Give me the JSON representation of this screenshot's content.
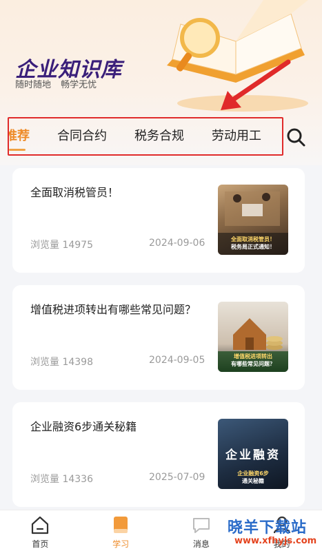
{
  "header": {
    "title": "企业知识库",
    "subtitle_left": "随时随地",
    "subtitle_right": "畅学无忧"
  },
  "tabs": [
    {
      "label": "推荐",
      "active": true
    },
    {
      "label": "合同合约",
      "active": false
    },
    {
      "label": "税务合规",
      "active": false
    },
    {
      "label": "劳动用工",
      "active": false
    }
  ],
  "articles": [
    {
      "title": "全面取消税管员！",
      "views": "浏览量 14975",
      "date": "2024-09-06",
      "thumb_line1": "全面取消税管员！",
      "thumb_line2": "税务局正式通知！"
    },
    {
      "title": "增值税进项转出有哪些常见问题？",
      "views": "浏览量 14398",
      "date": "2024-09-05",
      "thumb_line1": "增值税进项转出",
      "thumb_line2": "有哪些常见问题？"
    },
    {
      "title": "企业融资6步通关秘籍",
      "views": "浏览量 14336",
      "date": "2025-07-09",
      "thumb_big": "企业融资",
      "thumb_line1": "企业融资6步",
      "thumb_line2": "通关秘籍"
    }
  ],
  "tabbar": [
    {
      "label": "首页",
      "icon": "home-icon"
    },
    {
      "label": "学习",
      "icon": "book-icon",
      "active": true
    },
    {
      "label": "消息",
      "icon": "message-icon"
    },
    {
      "label": "我的",
      "icon": "profile-icon"
    }
  ],
  "watermark": {
    "text": "晓羊下载站",
    "url": "www.xfhyjs.com"
  },
  "colors": {
    "accent": "#ee8b28",
    "title_purple": "#3a1f7a",
    "highlight_box": "#e02a2a",
    "background": "#f4f5f8"
  }
}
